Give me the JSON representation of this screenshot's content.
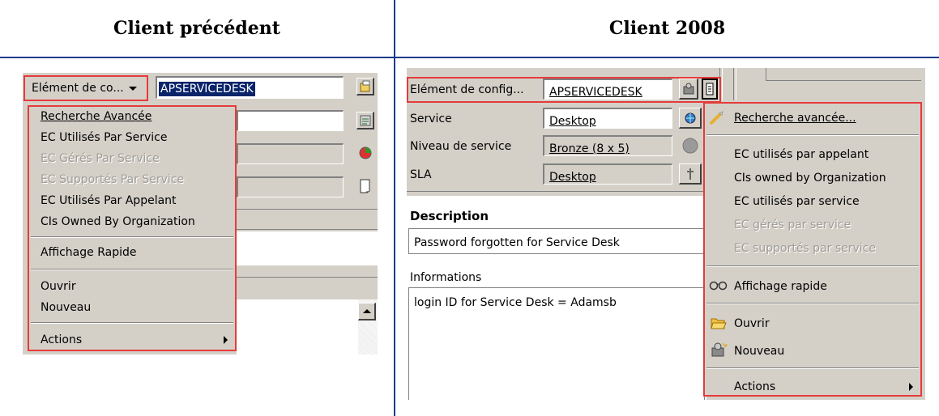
{
  "headers": {
    "left": "Client précédent",
    "right": "Client 2008"
  },
  "left": {
    "dropdown_label": "Elément de co...",
    "ci_value": "APSERVICEDESK",
    "menu": {
      "items": [
        "Recherche Avancée",
        "EC Utilisés Par Service",
        "EC Gérés Par Service",
        "EC Supportés Par Service",
        "EC Utilisés Par Appelant",
        "CIs Owned By Organization"
      ],
      "quick_view": "Affichage Rapide",
      "open": "Ouvrir",
      "new": "Nouveau",
      "actions": "Actions"
    }
  },
  "right": {
    "fields": [
      {
        "label": "Elément de config...",
        "value": "APSERVICEDESK"
      },
      {
        "label": "Service",
        "value": "Desktop"
      },
      {
        "label": "Niveau de service",
        "value": "Bronze (8 x 5)"
      },
      {
        "label": "SLA",
        "value": "Desktop"
      }
    ],
    "description_label": "Description",
    "description_value": "Password forgotten for Service Desk",
    "information_label": "Informations",
    "information_value": "login ID for Service Desk = Adamsb",
    "menu": {
      "advanced_search": "Recherche avancée...",
      "items": [
        "EC utilisés par appelant",
        "CIs owned by Organization",
        "EC utilisés par service",
        "EC gérés par service",
        "EC supportés par service"
      ],
      "quick_view": "Affichage rapide",
      "open": "Ouvrir",
      "new": "Nouveau",
      "actions": "Actions"
    }
  },
  "colors": {
    "highlight": "#e53b3b",
    "divider": "#1a3c8c",
    "window": "#d4d0c8"
  }
}
